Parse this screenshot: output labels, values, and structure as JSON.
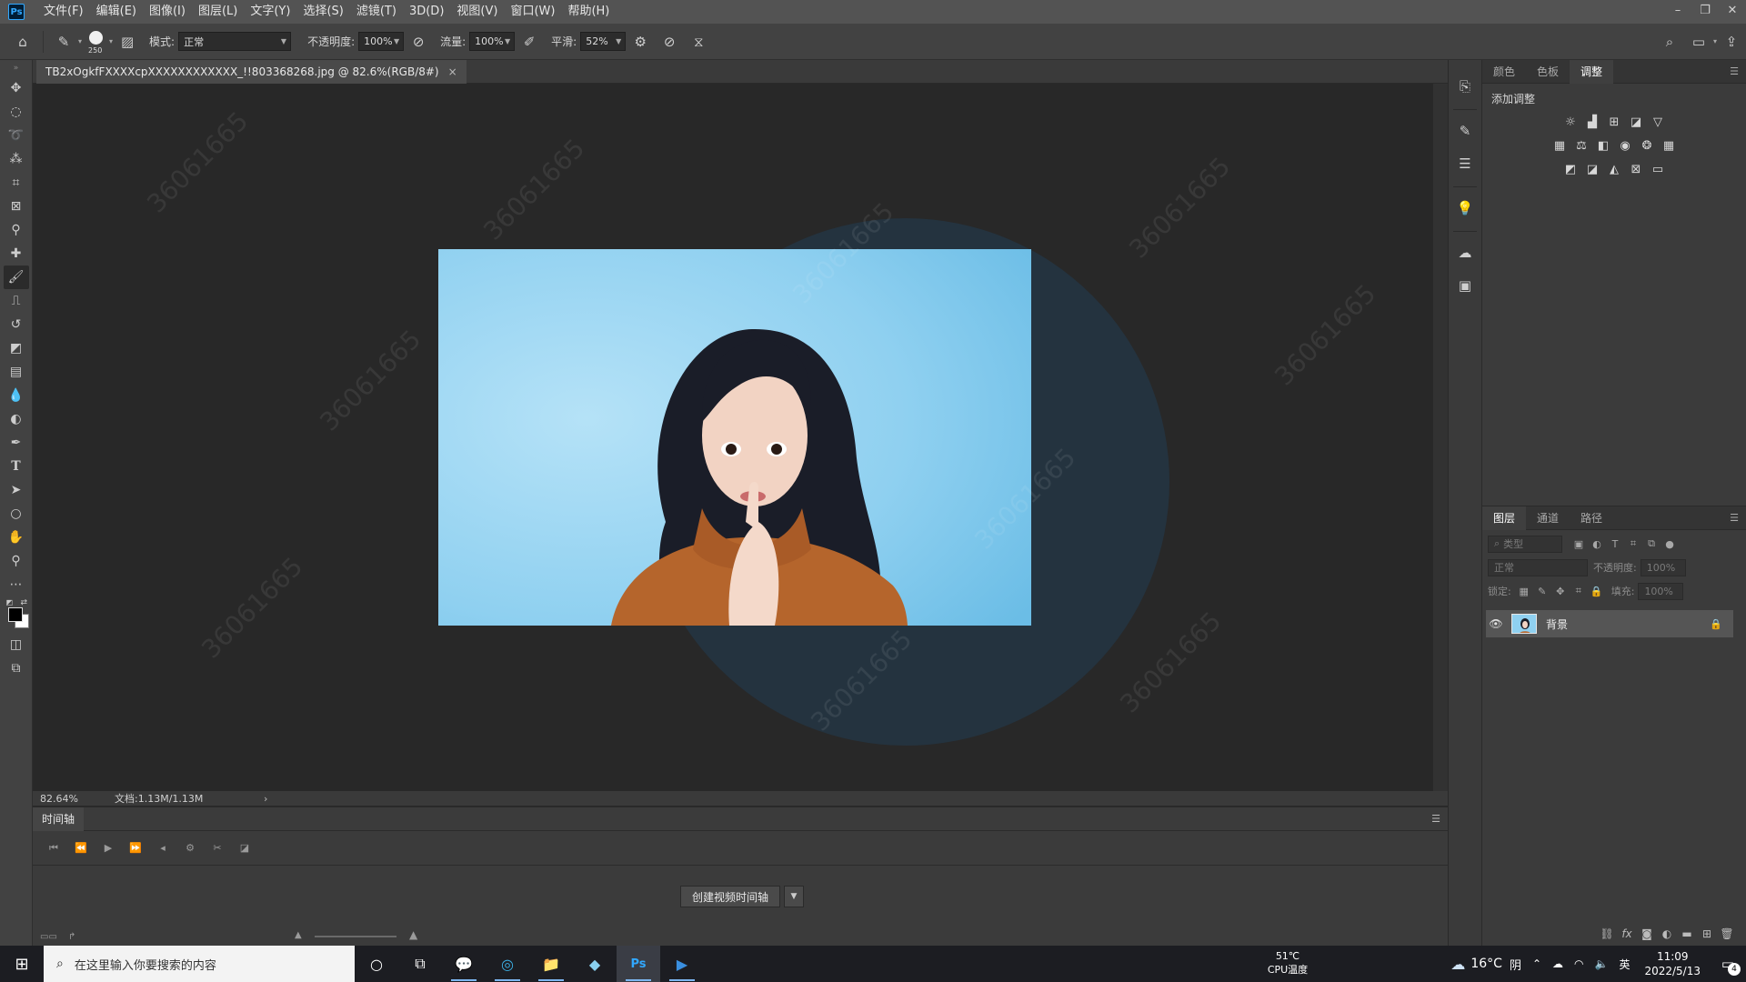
{
  "menubar": {
    "logo": "Ps",
    "items": [
      "文件(F)",
      "编辑(E)",
      "图像(I)",
      "图层(L)",
      "文字(Y)",
      "选择(S)",
      "滤镜(T)",
      "3D(D)",
      "视图(V)",
      "窗口(W)",
      "帮助(H)"
    ]
  },
  "options": {
    "brush_size": "250",
    "mode_label": "模式:",
    "mode_value": "正常",
    "opacity_label": "不透明度:",
    "opacity_value": "100%",
    "flow_label": "流量:",
    "flow_value": "100%",
    "smooth_label": "平滑:",
    "smooth_value": "52%"
  },
  "document": {
    "tab_title": "TB2xOgkfFXXXXcpXXXXXXXXXXXX_!!803368268.jpg @ 82.6%(RGB/8#)",
    "zoom": "82.64%",
    "doc_info": "文档:1.13M/1.13M"
  },
  "timeline": {
    "tab": "时间轴",
    "create_button": "创建视频时间轴"
  },
  "panels": {
    "top_tabs": [
      "颜色",
      "色板",
      "调整"
    ],
    "adjust_title": "添加调整",
    "layer_tabs": [
      "图层",
      "通道",
      "路径"
    ],
    "filter_placeholder": "类型",
    "blend_mode": "正常",
    "opacity_label": "不透明度:",
    "opacity_value": "100%",
    "lock_label": "锁定:",
    "fill_label": "填充:",
    "fill_value": "100%",
    "layer_name": "背景"
  },
  "watermark": "36061665",
  "taskbar": {
    "search_placeholder": "在这里输入你要搜索的内容",
    "cpu_temp_value": "51℃",
    "cpu_temp_label": "CPU温度",
    "weather_temp": "16°C",
    "weather_desc": "阴",
    "ime": "英",
    "time": "11:09",
    "date": "2022/5/13",
    "notifications": "4"
  },
  "colors": {
    "accent": "#31a8ff",
    "app_bg": "#282828",
    "panel_bg": "#3b3b3b",
    "image_sky": "#8fd0f0"
  }
}
